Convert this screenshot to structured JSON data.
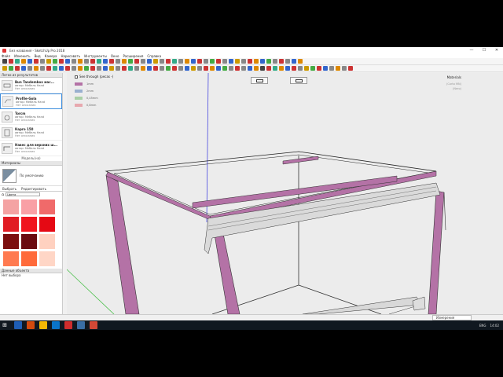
{
  "window": {
    "title": "Без названия - SketchUp Pro 2018",
    "controls": [
      "—",
      "☐",
      "✕"
    ]
  },
  "menu": [
    "Файл",
    "Изменить",
    "Вид",
    "Камера",
    "Нарисовать",
    "Инструменты",
    "Окно",
    "Расширения",
    "Справка"
  ],
  "toolbar_colors": [
    "#444",
    "#c33",
    "#3a8",
    "#d80",
    "#36c",
    "#c33",
    "#888",
    "#c90",
    "#4a4",
    "#c33",
    "#36c",
    "#888",
    "#d80",
    "#888",
    "#c33",
    "#3a8",
    "#36c",
    "#c33",
    "#888",
    "#d80",
    "#4a4",
    "#c33",
    "#888",
    "#36c",
    "#c90",
    "#888",
    "#c33",
    "#3a8",
    "#888",
    "#d80",
    "#36c",
    "#c33",
    "#888",
    "#4a4",
    "#c33",
    "#888",
    "#36c",
    "#c90",
    "#888",
    "#c33",
    "#d80",
    "#36c",
    "#4a4",
    "#888",
    "#c33",
    "#888",
    "#36c",
    "#d80"
  ],
  "left_panel": {
    "components_header": "Легко из результатов",
    "components": [
      {
        "name": "Bun Tandembox мас...",
        "author": "автор: Мебель Hand",
        "desc": "Нет описания"
      },
      {
        "name": "Profile-Gola",
        "author": "автор: Мебель Hand",
        "desc": "Нет описания"
      },
      {
        "name": "Torcm",
        "author": "автор: Мебель Hand",
        "desc": "Нет описания"
      },
      {
        "name": "Карго 150",
        "author": "автор: Мебель Hand",
        "desc": "Нет описания"
      },
      {
        "name": "Навес для верхних ш...",
        "author": "автор: Мебель Hand",
        "desc": "Нет описания"
      }
    ],
    "model_footer": "Модель(на)",
    "materials_header": "Материалы",
    "material_name": "По умолчанию",
    "tabs": [
      "Выбрать",
      "Редактировать"
    ],
    "dropdown": "Цвета",
    "swatches": [
      "#f4a3a3",
      "#f9a0a6",
      "#f06a6a",
      "#e11d24",
      "#f0141e",
      "#e50914",
      "#7c0e0e",
      "#6b0a10",
      "#ffd1c0",
      "#ff7a50",
      "#ff6a3a",
      "#ffd6c6"
    ],
    "entity_header": "Данные объекта",
    "entity_info": "Нет выбора"
  },
  "viewport": {
    "see_through": "See through (pecas -)",
    "legend": [
      {
        "label": "1mm",
        "color": "#b472a6"
      },
      {
        "label": "2mm",
        "color": "#99b0cf"
      },
      {
        "label": "0,45mm",
        "color": "#a9cfa6"
      },
      {
        "label": "0,8mm",
        "color": "#e7a8ae"
      }
    ],
    "right_title": "Materials",
    "right_items": [
      "(Corto MN)",
      "(Nero)"
    ]
  },
  "status": {
    "measurements": "Измерения"
  },
  "taskbar": {
    "app_colors": [
      "#1e5eb5",
      "#d24a0e",
      "#f2b705",
      "#0a74c9",
      "#cf2d2d",
      "#3a6ea5",
      "#d14836"
    ],
    "lang": "ENG",
    "time": "14:02"
  }
}
